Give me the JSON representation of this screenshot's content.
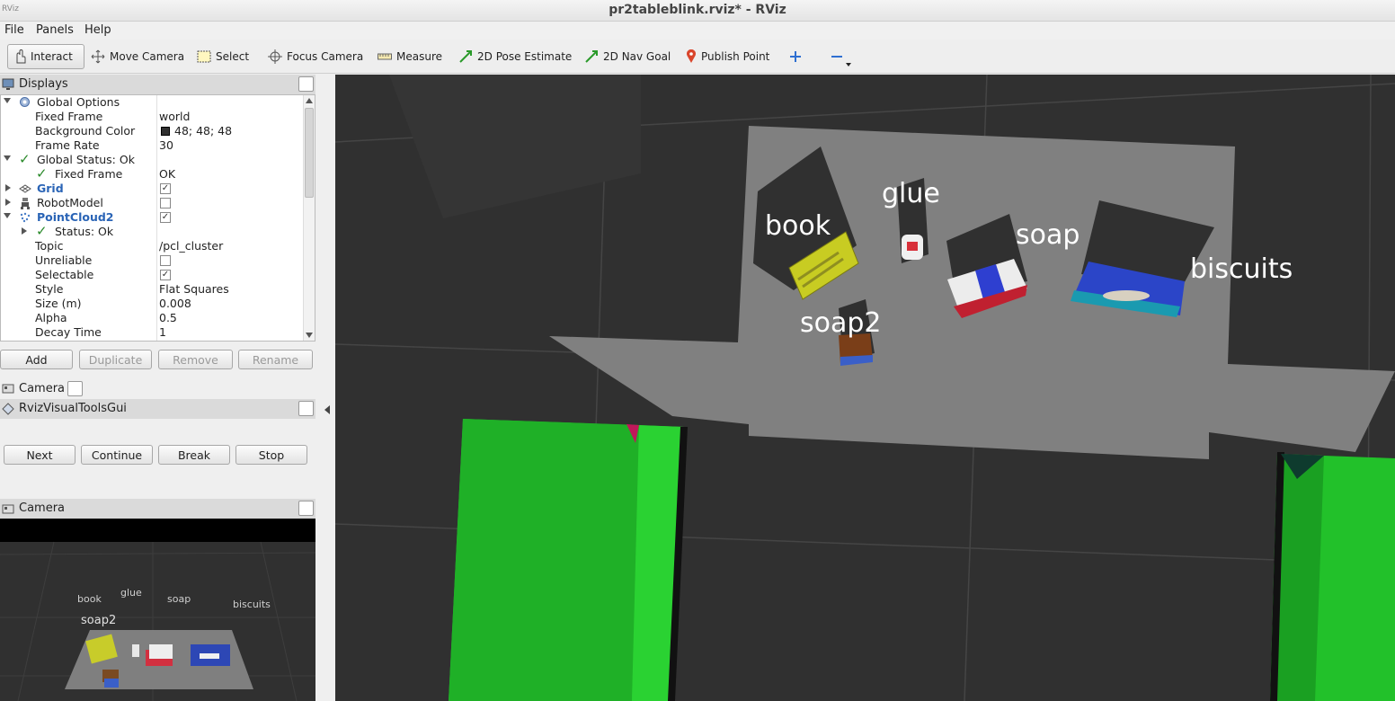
{
  "window": {
    "title": "pr2tableblink.rviz* - RViz"
  },
  "menu": {
    "file": "File",
    "panels": "Panels",
    "help": "Help"
  },
  "toolbar": {
    "interact": "Interact",
    "move_camera": "Move Camera",
    "select": "Select",
    "focus_camera": "Focus Camera",
    "measure": "Measure",
    "pose_estimate": "2D Pose Estimate",
    "nav_goal": "2D Nav Goal",
    "publish_point": "Publish Point"
  },
  "displays": {
    "title": "Displays",
    "rows": {
      "global_options": "Global Options",
      "fixed_frame_label": "Fixed Frame",
      "fixed_frame_value": "world",
      "bg_color_label": "Background Color",
      "bg_color_value": "48; 48; 48",
      "frame_rate_label": "Frame Rate",
      "frame_rate_value": "30",
      "global_status": "Global Status: Ok",
      "status_fixed_frame_label": "Fixed Frame",
      "status_fixed_frame_value": "OK",
      "grid": "Grid",
      "robot_model": "RobotModel",
      "pointcloud": "PointCloud2",
      "pc_status": "Status: Ok",
      "topic_label": "Topic",
      "topic_value": "/pcl_cluster",
      "unreliable_label": "Unreliable",
      "selectable_label": "Selectable",
      "style_label": "Style",
      "style_value": "Flat Squares",
      "size_label": "Size (m)",
      "size_value": "0.008",
      "alpha_label": "Alpha",
      "alpha_value": "0.5",
      "decay_label": "Decay Time",
      "decay_value": "1"
    },
    "checks": {
      "grid": true,
      "robot_model": false,
      "pointcloud": true,
      "unreliable": false,
      "selectable": true
    },
    "buttons": {
      "add": "Add",
      "duplicate": "Duplicate",
      "remove": "Remove",
      "rename": "Rename"
    }
  },
  "camera_header": "Camera",
  "rviz_tools": {
    "title": "RvizVisualToolsGui",
    "next": "Next",
    "continue": "Continue",
    "break": "Break",
    "stop": "Stop"
  },
  "camera_panel": {
    "title": "Camera"
  },
  "scene_labels": {
    "book": "book",
    "glue": "glue",
    "soap": "soap",
    "biscuits": "biscuits",
    "soap2": "soap2"
  },
  "colors": {
    "background": "#303030",
    "table": "#808080",
    "bin_green": "#22c12a",
    "accent_blue": "#2a64b6"
  }
}
